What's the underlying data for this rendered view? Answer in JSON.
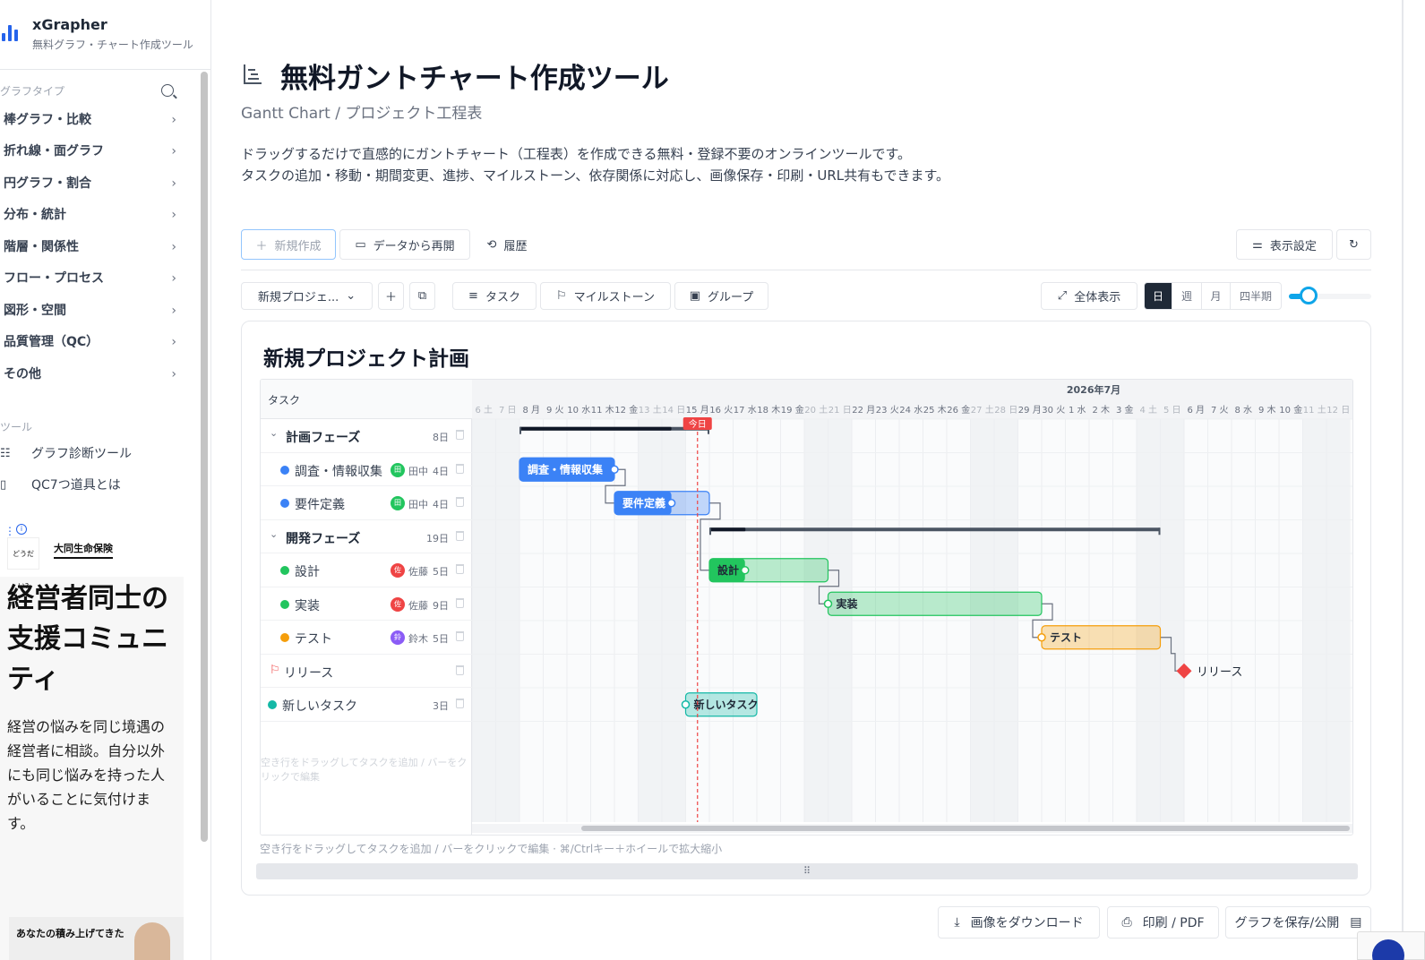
{
  "app": {
    "name": "xGrapher",
    "tagline": "無料グラフ・チャート作成ツール"
  },
  "sidebar": {
    "graph_section": "グラフタイプ",
    "items": [
      {
        "label": "棒グラフ・比較"
      },
      {
        "label": "折れ線・面グラフ"
      },
      {
        "label": "円グラフ・割合"
      },
      {
        "label": "分布・統計"
      },
      {
        "label": "階層・関係性"
      },
      {
        "label": "フロー・プロセス"
      },
      {
        "label": "図形・空間"
      },
      {
        "label": "品質管理（QC）"
      },
      {
        "label": "その他"
      }
    ],
    "tools_section": "ツール",
    "tools": [
      {
        "label": "グラフ診断ツール",
        "icon": "checklist-icon"
      },
      {
        "label": "QC7つ道具とは",
        "icon": "book-icon"
      }
    ]
  },
  "ad": {
    "logo_text": "どうだい?",
    "brand": "大同生命保険",
    "headline": "経営者同士の支援コミュニティ",
    "body": "経営の悩みを同じ境遇の経営者に相談。自分以外にも同じ悩みを持った人がいることに気付けます。",
    "bottom_text": "あなたの積み上げてきた"
  },
  "page": {
    "title": "無料ガントチャート作成ツール",
    "subtitle": "Gantt Chart / プロジェクト工程表",
    "desc_line1": "ドラッグするだけで直感的にガントチャート（工程表）を作成できる無料・登録不要のオンラインツールです。",
    "desc_line2": "タスクの追加・移動・期間変更、進捗、マイルストーン、依存関係に対応し、画像保存・印刷・URL共有もできます。"
  },
  "toolbar": {
    "new": "新規作成",
    "reopen": "データから再開",
    "history": "履歴",
    "display_settings": "表示設定",
    "project_select": "新規プロジェ...",
    "task": "タスク",
    "milestone": "マイルストーン",
    "group": "グループ",
    "fit_all": "全体表示",
    "scale_options": [
      "日",
      "週",
      "月",
      "四半期"
    ],
    "scale_selected": "日",
    "zoom_level": 0.24
  },
  "chart": {
    "title": "新規プロジェクト計画",
    "task_column": "タスク",
    "month_label": "2026年7月",
    "today_label": "今日",
    "empty_hint": "空き行をドラッグしてタスクを追加 / バーをクリックで編集",
    "footer_hint": "空き行をドラッグしてタスクを追加 / バーをクリックで編集 · ⌘/Ctrlキー＋ホイールで拡大縮小",
    "days": [
      "6 土",
      "7 日",
      "8 月",
      "9 火",
      "10 水",
      "11 木",
      "12 金",
      "13 土",
      "14 日",
      "15 月",
      "16 火",
      "17 水",
      "18 木",
      "19 金",
      "20 土",
      "21 日",
      "22 月",
      "23 火",
      "24 水",
      "25 木",
      "26 金",
      "27 土",
      "28 日",
      "29 月",
      "30 火",
      "1 水",
      "2 木",
      "3 金",
      "4 土",
      "5 日",
      "6 月",
      "7 火",
      "8 水",
      "9 木",
      "10 金",
      "11 土",
      "12 日"
    ],
    "weekend_days": [
      0,
      1,
      7,
      8,
      14,
      15,
      21,
      22,
      28,
      29,
      35,
      36
    ]
  },
  "chart_data": {
    "type": "gantt",
    "title": "新規プロジェクト計画",
    "today_index": 9.5,
    "rows": [
      {
        "kind": "group",
        "name": "計画フェーズ",
        "duration": "8日",
        "start": 2,
        "days": 8,
        "progress": 0.8
      },
      {
        "kind": "task",
        "name": "調査・情報収集",
        "assignee": "田中",
        "avatar": "田",
        "avatar_color": "#22c55e",
        "color": "#3b82f6",
        "duration": "4日",
        "start": 2,
        "days": 4,
        "progress": 1.0
      },
      {
        "kind": "task",
        "name": "要件定義",
        "assignee": "田中",
        "avatar": "田",
        "avatar_color": "#22c55e",
        "color": "#3b82f6",
        "duration": "4日",
        "start": 6,
        "days": 4,
        "progress": 0.6
      },
      {
        "kind": "group",
        "name": "開発フェーズ",
        "duration": "19日",
        "start": 10,
        "days": 19,
        "progress": 0.08
      },
      {
        "kind": "task",
        "name": "設計",
        "assignee": "佐藤",
        "avatar": "佐",
        "avatar_color": "#ef4444",
        "color": "#22c55e",
        "duration": "5日",
        "start": 10,
        "days": 5,
        "progress": 0.3
      },
      {
        "kind": "task",
        "name": "実装",
        "assignee": "佐藤",
        "avatar": "佐",
        "avatar_color": "#ef4444",
        "color": "#22c55e",
        "duration": "9日",
        "start": 15,
        "days": 9,
        "progress": 0.0
      },
      {
        "kind": "task",
        "name": "テスト",
        "assignee": "鈴木",
        "avatar": "鈴",
        "avatar_color": "#8b5cf6",
        "color": "#f59e0b",
        "duration": "5日",
        "start": 24,
        "days": 5,
        "progress": 0.0
      },
      {
        "kind": "milestone",
        "name": "リリース",
        "start": 30
      },
      {
        "kind": "task",
        "name": "新しいタスク",
        "color": "#14b8a6",
        "duration": "3日",
        "start": 9,
        "days": 3,
        "progress": 0.0
      }
    ],
    "dependencies": [
      [
        1,
        2
      ],
      [
        2,
        4
      ],
      [
        4,
        5
      ],
      [
        5,
        6
      ],
      [
        6,
        7
      ]
    ]
  },
  "bottom": {
    "download": "画像をダウンロード",
    "print": "印刷 / PDF",
    "save": "グラフを保存/公開"
  }
}
